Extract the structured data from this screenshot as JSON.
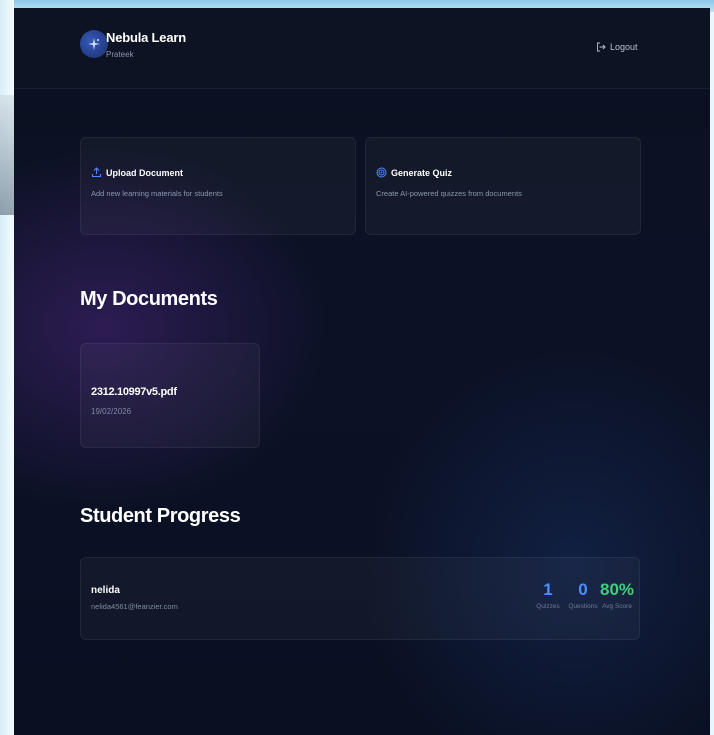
{
  "app": {
    "title": "Nebula Learn",
    "user": "Prateek"
  },
  "header": {
    "logout_label": "Logout"
  },
  "actions": [
    {
      "title": "Upload Document",
      "description": "Add new learning materials for students",
      "icon": "upload-icon"
    },
    {
      "title": "Generate Quiz",
      "description": "Create AI-powered quizzes from documents",
      "icon": "target-icon"
    }
  ],
  "documents": {
    "title": "My Documents",
    "items": [
      {
        "name": "2312.10997v5.pdf",
        "date": "19/02/2026"
      }
    ]
  },
  "progress": {
    "title": "Student Progress",
    "students": [
      {
        "name": "nelida",
        "email": "nelida4561@feanzier.com",
        "stats": [
          {
            "value": "1",
            "label": "Quizzes",
            "color": "#4f8cff"
          },
          {
            "value": "0",
            "label": "Questions",
            "color": "#4f8cff"
          },
          {
            "value": "80%",
            "label": "Avg Score",
            "color": "#3ecf7a"
          }
        ]
      }
    ]
  },
  "colors": {
    "background": "#0b1020",
    "accent_blue": "#4f8cff",
    "accent_green": "#3ecf7a"
  }
}
